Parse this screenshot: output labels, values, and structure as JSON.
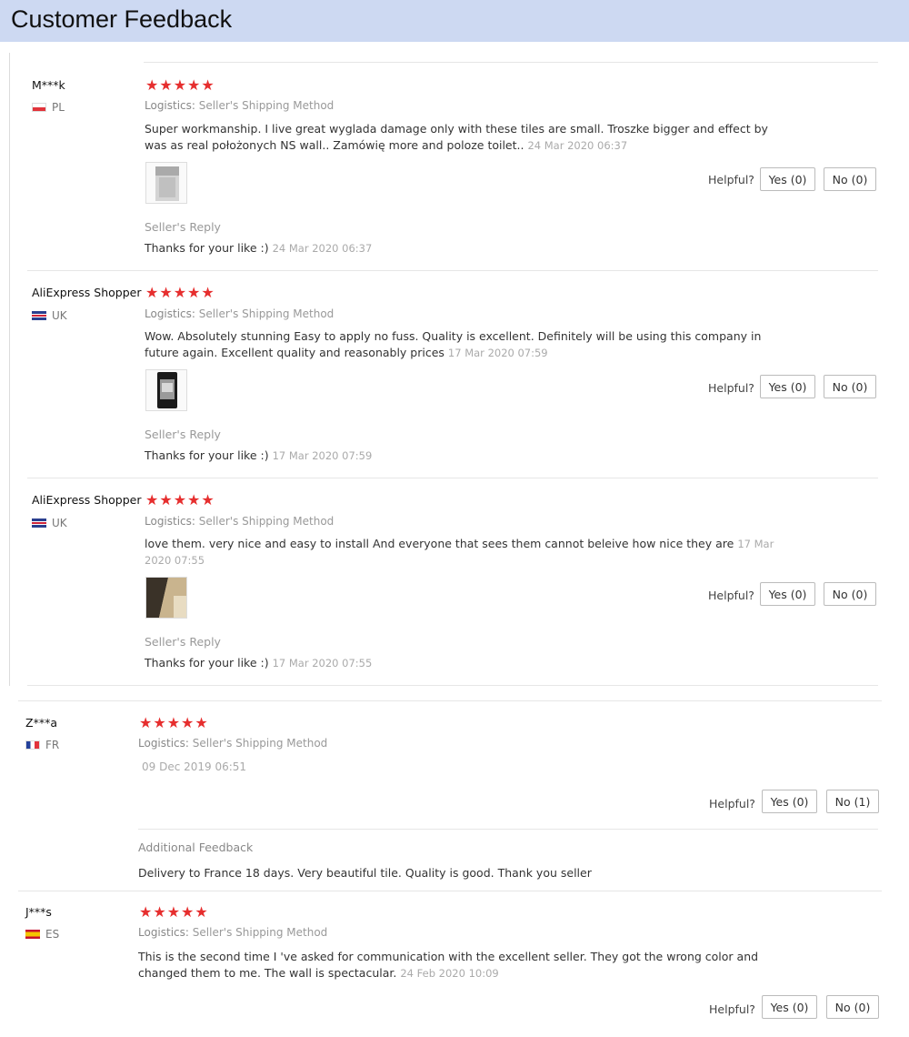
{
  "page": {
    "title": "Customer Feedback"
  },
  "common": {
    "logistics_label": "Logistics:",
    "logistics_value": "Seller's Shipping Method",
    "helpful_label": "Helpful?",
    "seller_reply_label": "Seller's Reply",
    "additional_feedback_label": "Additional Feedback",
    "stars": "★★★★★"
  },
  "reviews": [
    {
      "name": "M***k",
      "country": "PL",
      "flag": "poland-flag-icon",
      "rating": 5,
      "text": "Super workmanship. I live great wyglada damage only with these tiles are small. Troszke bigger and effect by was as real położonych NS wall.. Zamówię more and poloze toilet..",
      "date": "24 Mar 2020 06:37",
      "yes": "Yes (0)",
      "no": "No (0)",
      "reply": "Thanks for your like :)",
      "reply_date": "24 Mar 2020 06:37"
    },
    {
      "name": "AliExpress Shopper",
      "country": "UK",
      "flag": "uk-flag-icon",
      "rating": 5,
      "text": "Wow. Absolutely stunning Easy to apply no fuss. Quality is excellent. Definitely will be using this company in future again. Excellent quality and reasonably prices",
      "date": "17 Mar 2020 07:59",
      "yes": "Yes (0)",
      "no": "No (0)",
      "reply": "Thanks for your like :)",
      "reply_date": "17 Mar 2020 07:59"
    },
    {
      "name": "AliExpress Shopper",
      "country": "UK",
      "flag": "uk-flag-icon",
      "rating": 5,
      "text": "love them. very nice and easy to install And everyone that sees them cannot beleive how nice they are",
      "date": "17 Mar 2020 07:55",
      "yes": "Yes (0)",
      "no": "No (0)",
      "reply": "Thanks for your like :)",
      "reply_date": "17 Mar 2020 07:55"
    },
    {
      "name": "Z***a",
      "country": "FR",
      "flag": "france-flag-icon",
      "rating": 5,
      "date": "09 Dec 2019 06:51",
      "yes": "Yes (0)",
      "no": "No (1)",
      "additional": "Delivery to France 18 days. Very beautiful tile. Quality is good. Thank you seller"
    },
    {
      "name": "J***s",
      "country": "ES",
      "flag": "spain-flag-icon",
      "rating": 5,
      "text": "This is the second time I 've asked for communication with the excellent seller. They got the wrong color and changed them to me. The wall is spectacular.",
      "date": "24 Feb 2020 10:09",
      "yes": "Yes (0)",
      "no": "No (0)"
    }
  ]
}
